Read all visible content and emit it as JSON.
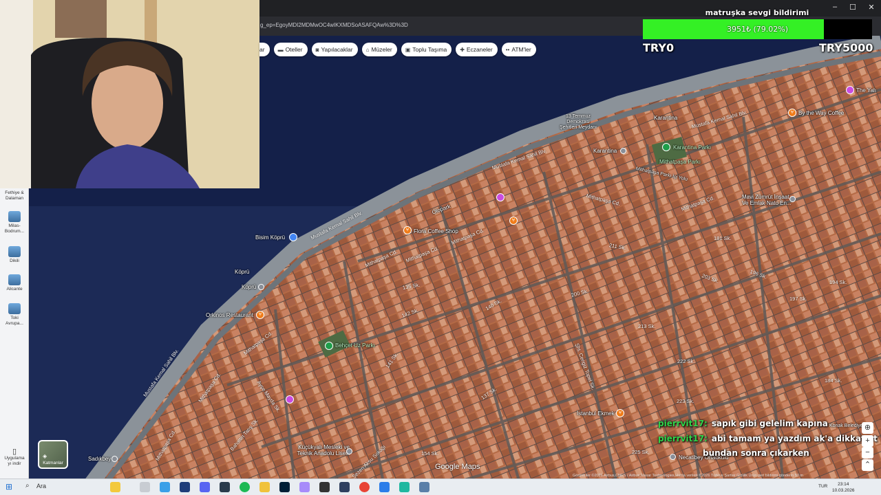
{
  "browser": {
    "url": "g_ep=EgoyMDI2MDMwOC4wIKXMDSoASAFQAw%3D%3D",
    "window_controls": [
      "–",
      "☐",
      "✕"
    ]
  },
  "map_chips": [
    {
      "icon": "hotel-icon",
      "glyph": "▬",
      "label": "Oteller"
    },
    {
      "icon": "attractions-icon",
      "glyph": "◙",
      "label": "Yapılacaklar"
    },
    {
      "icon": "museum-icon",
      "glyph": "⌂",
      "label": "Müzeler"
    },
    {
      "icon": "transit-icon",
      "glyph": "▣",
      "label": "Toplu Taşıma"
    },
    {
      "icon": "pharmacy-icon",
      "glyph": "✚",
      "label": "Eczaneler"
    },
    {
      "icon": "atm-icon",
      "glyph": "••",
      "label": "ATM'ler"
    }
  ],
  "chip_cut_label": "ar",
  "left_panel": {
    "items": [
      {
        "label1": "Fethiye &",
        "label2": "Dalaman"
      },
      {
        "label1": "Milas-",
        "label2": "Bodrum..."
      },
      {
        "label1": "Dikili",
        "label2": ""
      },
      {
        "label1": "Alicante",
        "label2": ""
      },
      {
        "label1": "Toki",
        "label2": "Avrupa..."
      }
    ],
    "download_label1": "Uygulama",
    "download_label2": "yı indir"
  },
  "layers_label": "Katmanlar",
  "donation": {
    "title": "matruşka sevgi bildirimi",
    "progress_text": "3951₺ (79.02%)",
    "progress_fraction": 0.7902,
    "current_amount": "TRY0",
    "goal_amount": "TRY5000",
    "fill_color": "#34f025"
  },
  "map_labels": {
    "places": [
      {
        "name": "Bisim Köprü",
        "kind": "blue"
      },
      {
        "name": "Köprü",
        "kind": "grey"
      },
      {
        "name": "Köprü",
        "kind": "grey"
      },
      {
        "name": "Orkinos Restaurant",
        "kind": "orange"
      },
      {
        "name": "Flora Coffee Shop",
        "kind": "orange"
      },
      {
        "name": "Karantina",
        "kind": "grey"
      },
      {
        "name": "Karantina",
        "kind": "grey"
      },
      {
        "name": "Karantina Parkı",
        "kind": "green"
      },
      {
        "name": "Mithatpaşa Parkı",
        "kind": "text"
      },
      {
        "name": "By the Way Coffee",
        "kind": "orange"
      },
      {
        "name": "Mavi Zümrüt İnşaat Ve Emlak Nato En...",
        "kind": "grey"
      },
      {
        "name": "Behçet Uz Parkı",
        "kind": "green"
      },
      {
        "name": "Küçükyalı Mesleki ve Teknik Anadolu Lisesi",
        "kind": "grey"
      },
      {
        "name": "İstanbul Ekmek",
        "kind": "orange"
      },
      {
        "name": "Necatibey Ortaokulu",
        "kind": "grey"
      },
      {
        "name": "Sadıkbey",
        "kind": "grey"
      },
      {
        "name": "Olopark",
        "kind": "text"
      },
      {
        "name": "13 Temmuz Demokrasi Şehitleri Meydanı",
        "kind": "text"
      },
      {
        "name": "Mithatpaşa Parkı İçi Yolu",
        "kind": "text"
      },
      {
        "name": "Konak Belediyesi",
        "kind": "text"
      },
      {
        "name": "The Yalı",
        "kind": "purple"
      }
    ],
    "streets": [
      "Mustafa Kemal Sahil Blv.",
      "Mustafa Kemal Sahil Blv.",
      "Mustafa Kemal Sahil Blv.",
      "Mustafa Kemal Sahil Blv.",
      "Mithatpaşa Cd.",
      "Mithatpaşa Cd.",
      "Mithatpaşa Cd.",
      "Mithatpaşa Cd.",
      "Mithatpaşa Cd.",
      "Mithatpaşa Cd.",
      "Mithatpaşa Cd.",
      "Mithatpaşa Cd.",
      "135 Sk.",
      "141 Sk.",
      "142 Sk.",
      "140 Sk.",
      "137 Sk.",
      "200 Sk.",
      "203 Sk.",
      "211 Sk.",
      "213 Sk.",
      "222 Sk.",
      "223 Sk.",
      "225 Sk.",
      "181 Sk.",
      "184 Sk.",
      "194 Sk.",
      "196 Sk.",
      "197 Sk.",
      "154 Sk.",
      "Sezen Aksu Sokağı",
      "Ayşe Mayda Sk.",
      "Bahattin Tatış Sk.",
      "Şht. Cengiz Topel Sk."
    ]
  },
  "chat": [
    {
      "user": "pierrvit17:",
      "text": "sapık gibi gelelim kapına"
    },
    {
      "user": "pierrvit17:",
      "text": "abi tamam ya yazdım ak'a dikkat et"
    },
    {
      "user": "",
      "text": "bundan sonra çıkarken"
    }
  ],
  "map_controls": [
    "⊕",
    "+",
    "−",
    "⌃"
  ],
  "google_maps_label": "Google Maps",
  "attribution": "Görüntüler ©2026 Airbus,CNES / Airbus,Maxar Technologies,Harita verileri ©2026  Türkiye  Şartlar  Gizlilik  Ürün geri bildirimi gönderin  50 m",
  "taskbar": {
    "search_label": "Ara",
    "language": "TUR",
    "time": "23:14",
    "date": "10.03.2026"
  }
}
